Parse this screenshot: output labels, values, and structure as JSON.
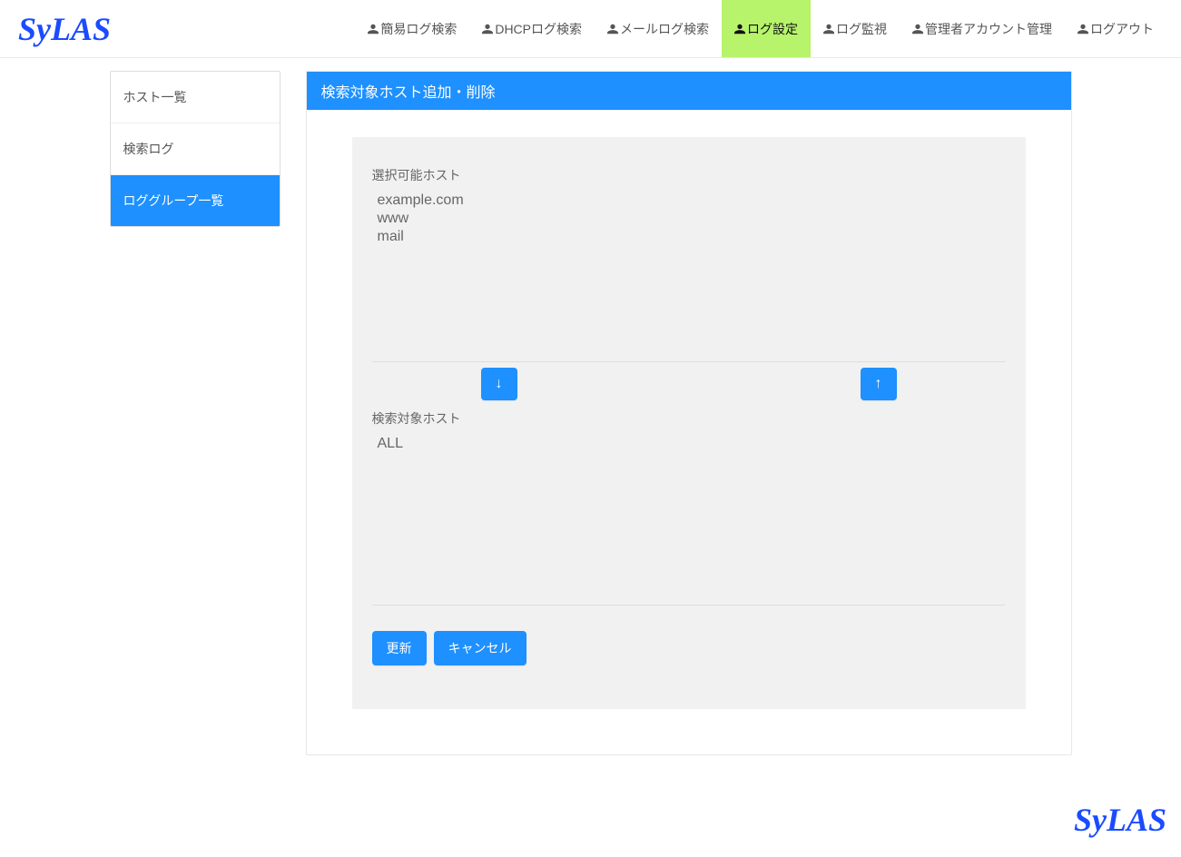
{
  "brand": "SyLAS",
  "nav": {
    "items": [
      {
        "label": "簡易ログ検索",
        "active": false
      },
      {
        "label": "DHCPログ検索",
        "active": false
      },
      {
        "label": "メールログ検索",
        "active": false
      },
      {
        "label": "ログ設定",
        "active": true
      },
      {
        "label": "ログ監視",
        "active": false
      },
      {
        "label": "管理者アカウント管理",
        "active": false
      },
      {
        "label": "ログアウト",
        "active": false
      }
    ]
  },
  "sidebar": {
    "items": [
      {
        "label": "ホスト一覧",
        "active": false
      },
      {
        "label": "検索ログ",
        "active": false
      },
      {
        "label": "ロググループ一覧",
        "active": true
      }
    ]
  },
  "panel": {
    "title": "検索対象ホスト追加・削除",
    "available_label": "選択可能ホスト",
    "available_hosts": [
      "example.com",
      "www",
      "mail"
    ],
    "down_arrow": "↓",
    "up_arrow": "↑",
    "target_label": "検索対象ホスト",
    "target_hosts": [
      "ALL"
    ],
    "update_label": "更新",
    "cancel_label": "キャンセル"
  },
  "footer": {
    "brand": "SyLAS"
  }
}
